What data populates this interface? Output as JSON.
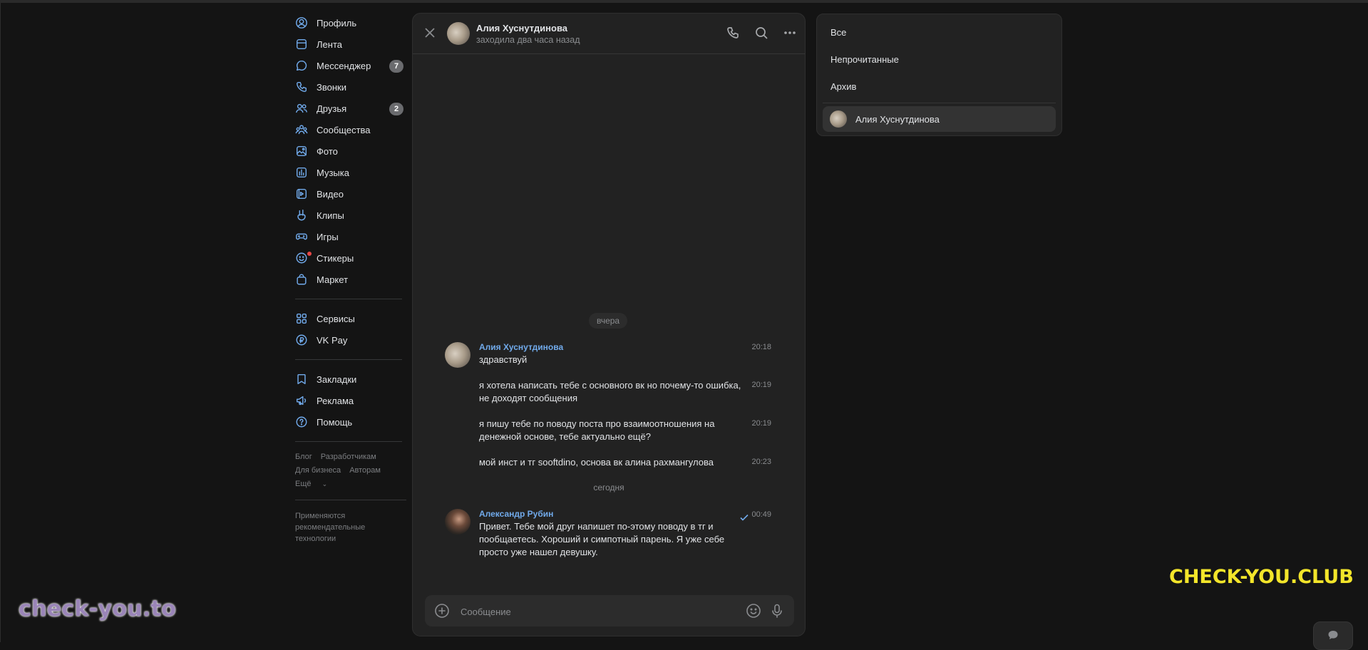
{
  "sidebar": {
    "items": [
      {
        "label": "Профиль",
        "icon": "profile-icon"
      },
      {
        "label": "Лента",
        "icon": "feed-icon"
      },
      {
        "label": "Мессенджер",
        "icon": "messenger-icon",
        "badge": "7"
      },
      {
        "label": "Звонки",
        "icon": "phone-icon"
      },
      {
        "label": "Друзья",
        "icon": "friends-icon",
        "badge": "2"
      },
      {
        "label": "Сообщества",
        "icon": "communities-icon"
      },
      {
        "label": "Фото",
        "icon": "photo-icon"
      },
      {
        "label": "Музыка",
        "icon": "music-icon"
      },
      {
        "label": "Видео",
        "icon": "video-icon"
      },
      {
        "label": "Клипы",
        "icon": "clips-icon"
      },
      {
        "label": "Игры",
        "icon": "gamepad-icon"
      },
      {
        "label": "Стикеры",
        "icon": "smile-icon"
      },
      {
        "label": "Маркет",
        "icon": "shopping-bag-icon"
      }
    ],
    "items2": [
      {
        "label": "Сервисы",
        "icon": "services-icon"
      },
      {
        "label": "VK Pay",
        "icon": "vkpay-icon"
      }
    ],
    "items3": [
      {
        "label": "Закладки",
        "icon": "bookmark-icon"
      },
      {
        "label": "Реклама",
        "icon": "megaphone-icon"
      },
      {
        "label": "Помощь",
        "icon": "help-icon"
      }
    ],
    "footer": {
      "blog": "Блог",
      "developers": "Разработчикам",
      "business": "Для бизнеса",
      "authors": "Авторам",
      "more": "Ещё",
      "note": "Применяются рекомендательные технологии"
    }
  },
  "chat": {
    "contact_name": "Алия Хуснутдинова",
    "contact_status": "заходила два часа назад",
    "date_yesterday": "вчера",
    "date_today": "сегодня",
    "messages": [
      {
        "sender": "Алия Хуснутдинова",
        "text": "здравствуй",
        "time": "20:18"
      },
      {
        "text": "я хотела написать тебе с основного вк но почему-то ошибка, не доходят сообщения",
        "time": "20:19"
      },
      {
        "text": "я пишу тебе по поводу поста про взаимоотношения на денежной основе, тебе актуально ещё?",
        "time": "20:19"
      },
      {
        "text": "мой инст и тг sooftdino, основа вк алина рахмангулова",
        "time": "20:23"
      },
      {
        "sender": "Александр Рубин",
        "text": "Привет. Тебе мой друг напишет по-этому поводу в тг и пообщаетесь. Хороший и симпотный парень. Я уже себе просто уже нашел девушку.",
        "time": "00:49",
        "read": true
      }
    ],
    "composer_placeholder": "Сообщение"
  },
  "filters": {
    "all": "Все",
    "unread": "Непрочитанные",
    "archive": "Архив",
    "conversation": "Алия Хуснутдинова"
  },
  "watermarks": {
    "left": "check-you.to",
    "right": "CHECK-YOU.CLUB"
  },
  "colors": {
    "background": "#141414",
    "panel": "#222222",
    "accent": "#71aaeb",
    "text": "#e1e3e6",
    "muted": "#8a8c8f",
    "badge": "#6a6b6e",
    "watermark_yellow": "#f3e52a"
  }
}
